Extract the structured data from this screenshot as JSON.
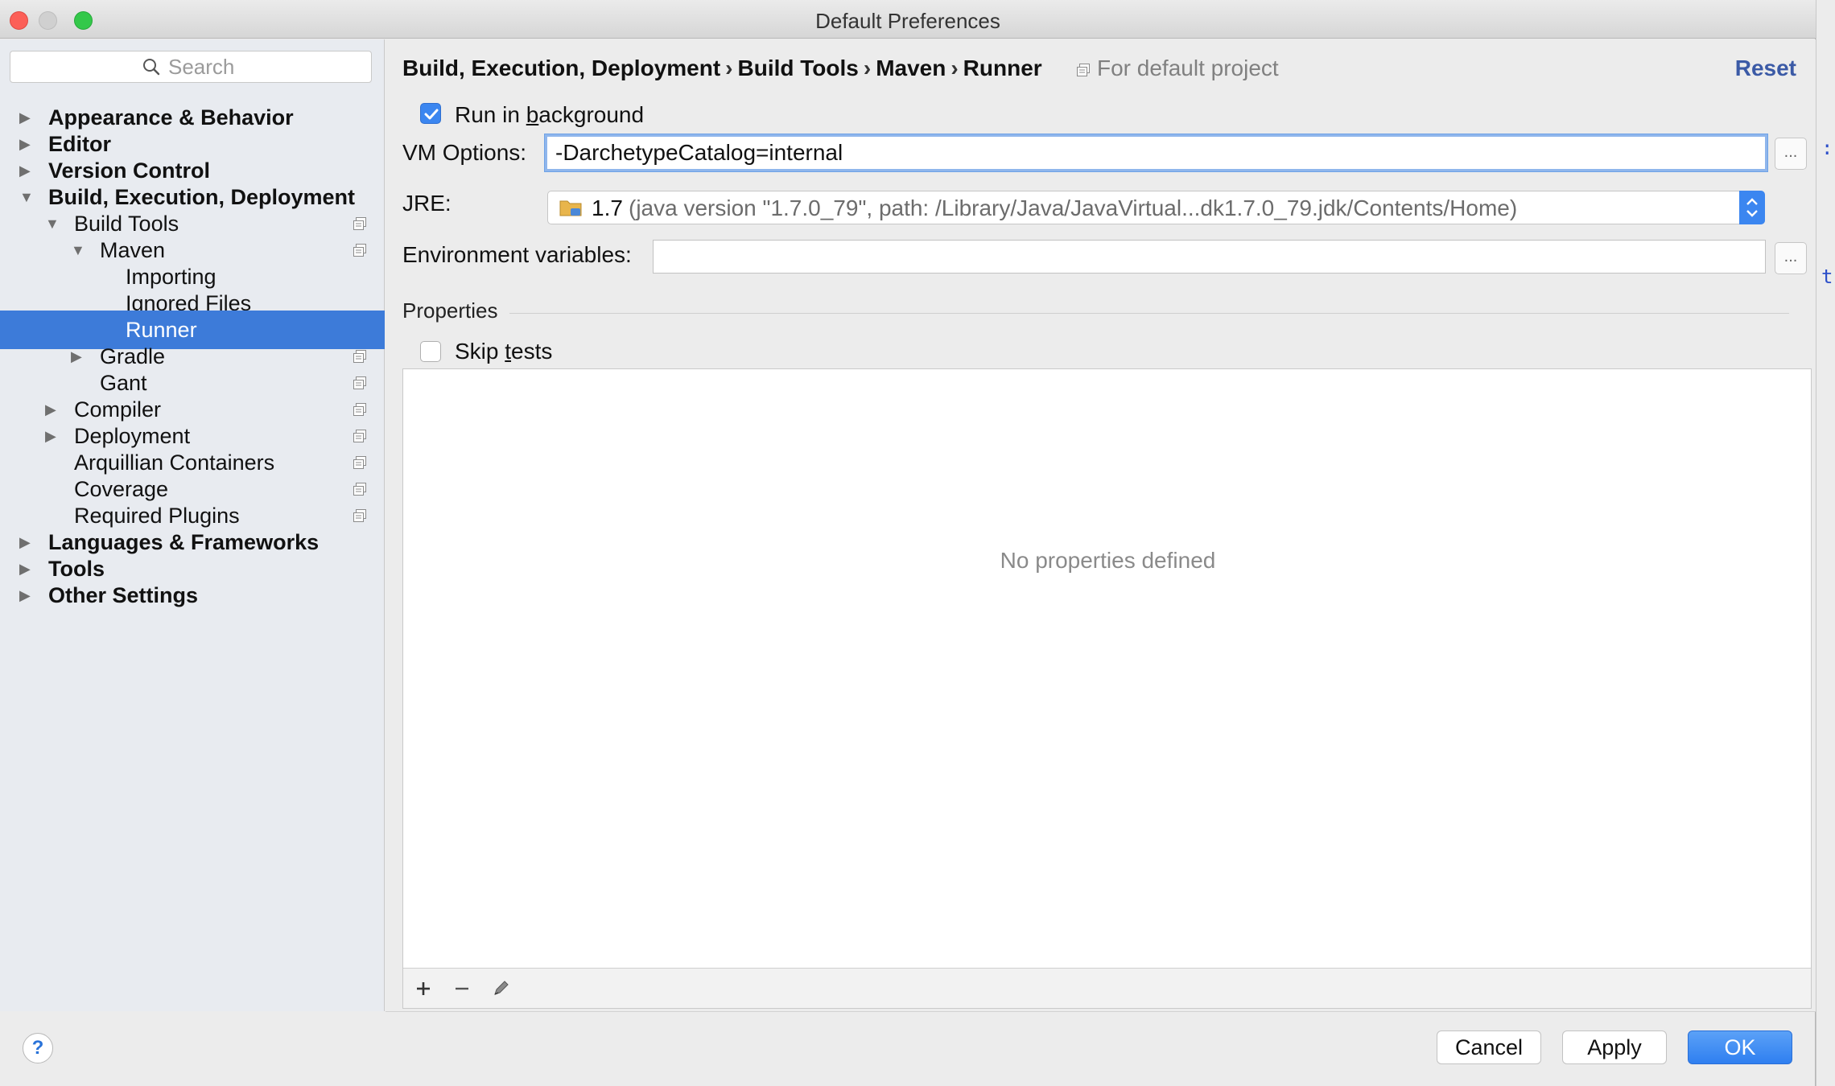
{
  "window": {
    "title": "Default Preferences"
  },
  "search": {
    "placeholder": "Search"
  },
  "sidebar": {
    "items": [
      {
        "label": "Appearance & Behavior",
        "arrow": "▶"
      },
      {
        "label": "Editor",
        "arrow": "▶"
      },
      {
        "label": "Version Control",
        "arrow": "▶"
      },
      {
        "label": "Build, Execution, Deployment",
        "arrow": "▼"
      },
      {
        "label": "Build Tools",
        "arrow": "▼"
      },
      {
        "label": "Maven",
        "arrow": "▼"
      },
      {
        "label": "Importing",
        "arrow": ""
      },
      {
        "label": "Ignored Files",
        "arrow": ""
      },
      {
        "label": "Runner",
        "arrow": ""
      },
      {
        "label": "Gradle",
        "arrow": "▶"
      },
      {
        "label": "Gant",
        "arrow": ""
      },
      {
        "label": "Compiler",
        "arrow": "▶"
      },
      {
        "label": "Deployment",
        "arrow": "▶"
      },
      {
        "label": "Arquillian Containers",
        "arrow": ""
      },
      {
        "label": "Coverage",
        "arrow": ""
      },
      {
        "label": "Required Plugins",
        "arrow": ""
      },
      {
        "label": "Languages & Frameworks",
        "arrow": "▶"
      },
      {
        "label": "Tools",
        "arrow": "▶"
      },
      {
        "label": "Other Settings",
        "arrow": "▶"
      }
    ],
    "selected": "Runner"
  },
  "breadcrumb": {
    "parts": [
      "Build, Execution, Deployment",
      "Build Tools",
      "Maven",
      "Runner"
    ],
    "separator": "›",
    "scope": "For default project"
  },
  "reset_label": "Reset",
  "run_in_background": {
    "pre": "Run in ",
    "mnemonic": "b",
    "post": "ackground",
    "checked": true
  },
  "vm_options": {
    "label": "VM Options:",
    "value": "-DarchetypeCatalog=internal"
  },
  "jre": {
    "label": "JRE:",
    "version": "1.7",
    "detail": "(java version \"1.7.0_79\", path: /Library/Java/JavaVirtual...dk1.7.0_79.jdk/Contents/Home)"
  },
  "env_vars": {
    "label": "Environment variables:",
    "value": ""
  },
  "ellipsis": "...",
  "properties": {
    "title": "Properties",
    "empty_text": "No properties defined"
  },
  "skip_tests": {
    "pre": "Skip ",
    "mnemonic": "t",
    "post": "ests",
    "checked": false
  },
  "buttons": {
    "help": "?",
    "cancel": "Cancel",
    "apply": "Apply",
    "ok": "OK"
  },
  "colors": {
    "selection": "#3d7bd9",
    "accent": "#3b86f0",
    "link": "#3b5aa6"
  }
}
